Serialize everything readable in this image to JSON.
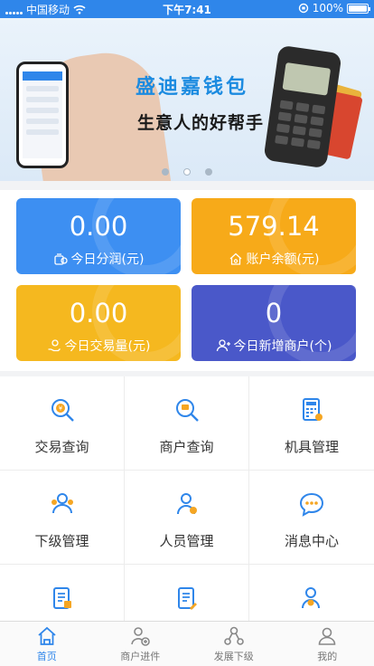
{
  "status_bar": {
    "carrier": "中国移动",
    "time": "下午7:41",
    "battery": "100%"
  },
  "banner": {
    "title": "盛迪嘉钱包",
    "subtitle": "生意人的好帮手",
    "slides": 3,
    "active_slide": 1
  },
  "stats": [
    {
      "value": "0.00",
      "label": "今日分润(元)",
      "color": "#3d8ff2",
      "icon": "money-bag-icon"
    },
    {
      "value": "579.14",
      "label": "账户余额(元)",
      "color": "#f7aa19",
      "icon": "house-icon"
    },
    {
      "value": "0.00",
      "label": "今日交易量(元)",
      "color": "#f5b81f",
      "icon": "hand-coin-icon"
    },
    {
      "value": "0",
      "label": "今日新增商户(个)",
      "color": "#4a58c9",
      "icon": "user-add-icon"
    }
  ],
  "menu": [
    {
      "label": "交易查询",
      "icon": "yen-search-icon"
    },
    {
      "label": "商户查询",
      "icon": "shop-search-icon"
    },
    {
      "label": "机具管理",
      "icon": "calculator-icon"
    },
    {
      "label": "下级管理",
      "icon": "team-icon"
    },
    {
      "label": "人员管理",
      "icon": "person-icon"
    },
    {
      "label": "消息中心",
      "icon": "message-icon"
    },
    {
      "label": "",
      "icon": "document-icon"
    },
    {
      "label": "",
      "icon": "form-icon"
    },
    {
      "label": "",
      "icon": "user-badge-icon"
    }
  ],
  "tabbar": [
    {
      "label": "首页",
      "icon": "home-icon",
      "active": true
    },
    {
      "label": "商户进件",
      "icon": "merchant-add-icon",
      "active": false
    },
    {
      "label": "发展下级",
      "icon": "network-icon",
      "active": false
    },
    {
      "label": "我的",
      "icon": "profile-icon",
      "active": false
    }
  ],
  "colors": {
    "primary": "#2f86ea",
    "icon_accent": "#f5a623"
  }
}
